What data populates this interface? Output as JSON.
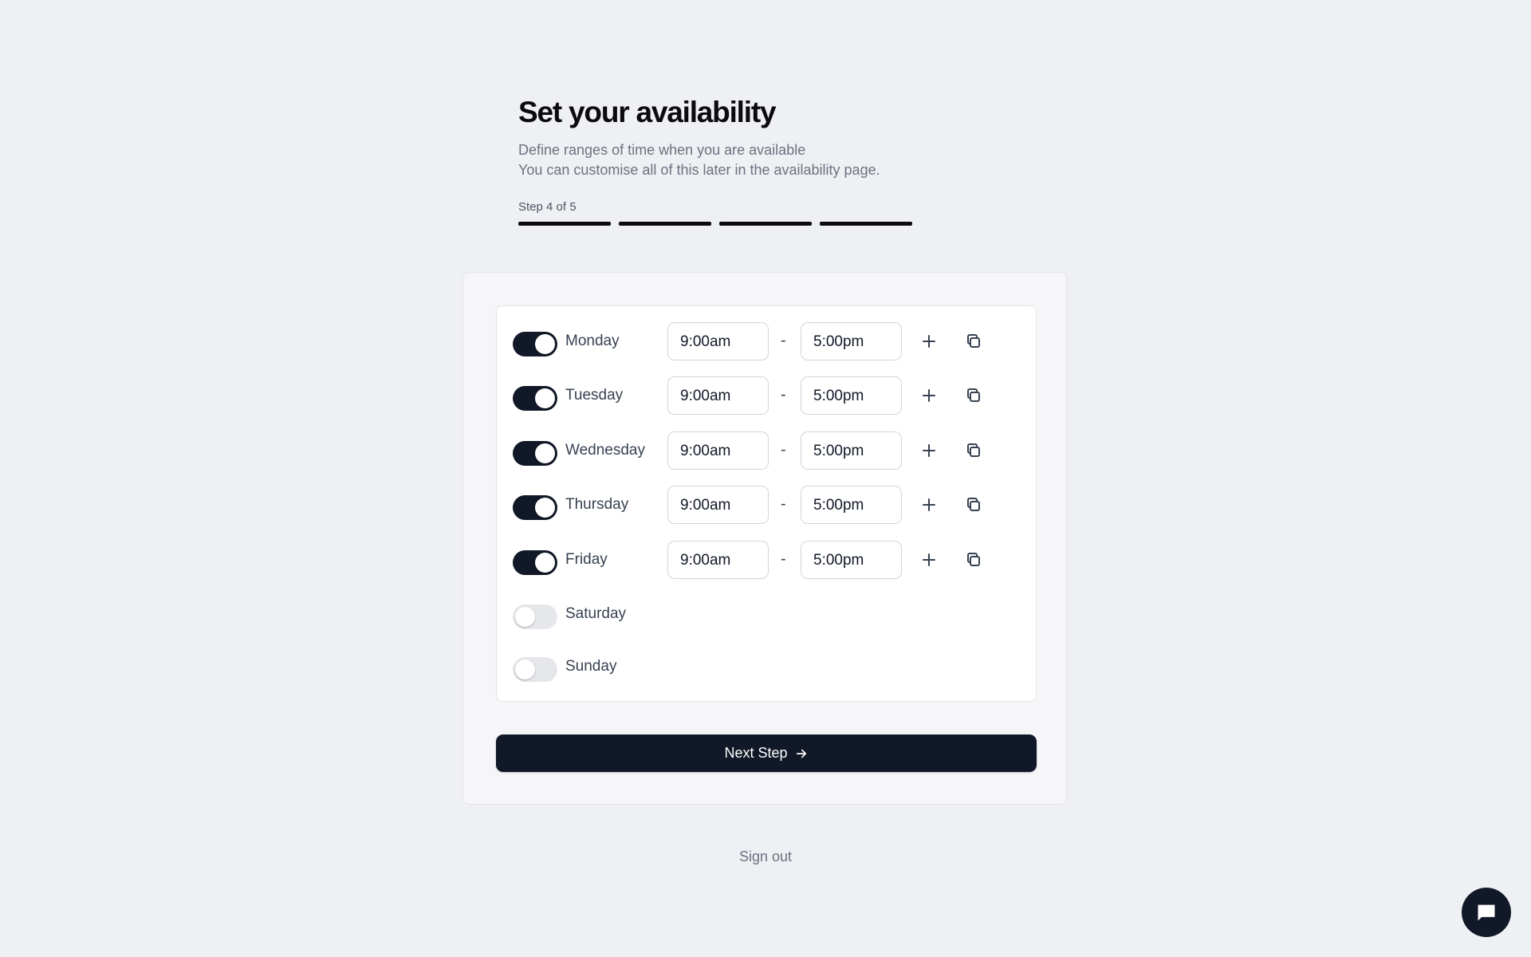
{
  "header": {
    "title": "Set your availability",
    "subtitle_line1": "Define ranges of time when you are available",
    "subtitle_line2": "You can customise all of this later in the availability page.",
    "step_label": "Step 4 of 5",
    "steps_total": 5,
    "steps_completed": 4
  },
  "schedule": {
    "days": [
      {
        "label": "Monday",
        "enabled": true,
        "start": "9:00am",
        "end": "5:00pm"
      },
      {
        "label": "Tuesday",
        "enabled": true,
        "start": "9:00am",
        "end": "5:00pm"
      },
      {
        "label": "Wednesday",
        "enabled": true,
        "start": "9:00am",
        "end": "5:00pm"
      },
      {
        "label": "Thursday",
        "enabled": true,
        "start": "9:00am",
        "end": "5:00pm"
      },
      {
        "label": "Friday",
        "enabled": true,
        "start": "9:00am",
        "end": "5:00pm"
      },
      {
        "label": "Saturday",
        "enabled": false
      },
      {
        "label": "Sunday",
        "enabled": false
      }
    ],
    "range_separator": "-"
  },
  "actions": {
    "next_label": "Next Step",
    "signout_label": "Sign out"
  },
  "icons": {
    "add": "plus-icon",
    "copy": "copy-icon",
    "next": "arrow-right-icon",
    "chat": "chat-bubble-icon"
  },
  "colors": {
    "primary": "#111827",
    "background": "#eff0f3",
    "toggle_off": "#e5e7eb"
  }
}
